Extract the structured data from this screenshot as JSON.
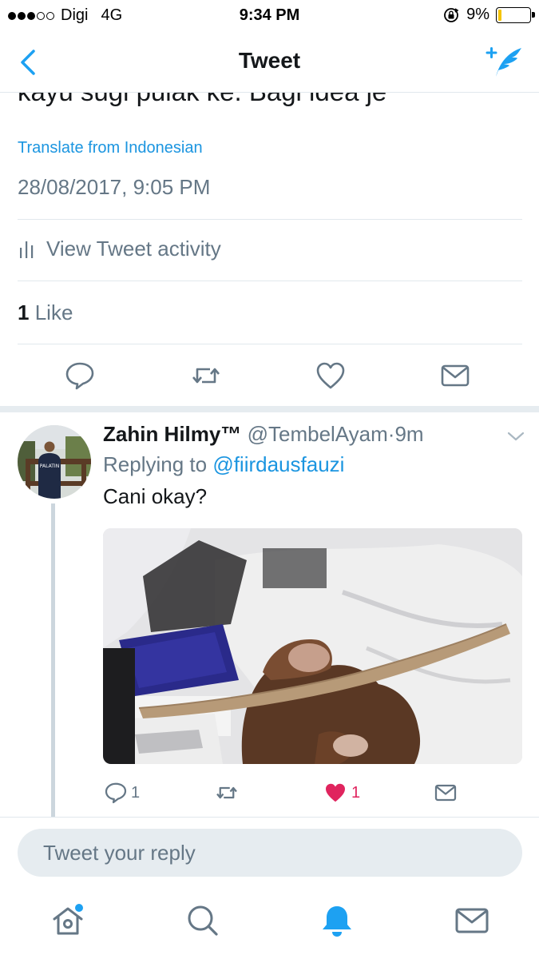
{
  "status_bar": {
    "carrier": "Digi",
    "network": "4G",
    "time": "9:34 PM",
    "battery": "9%",
    "battery_color": "#f5c400"
  },
  "nav": {
    "title": "Tweet",
    "back_icon": "chevron-left-icon",
    "compose_icon": "compose-quill-icon"
  },
  "tweet": {
    "text": "kayu sugi pulak ke. Bagi idea je",
    "translate_label": "Translate from Indonesian",
    "timestamp": "28/08/2017, 9:05 PM",
    "activity_label": "View Tweet activity",
    "likes_count": "1",
    "likes_label": "Like"
  },
  "reply": {
    "display_name": "Zahin Hilmy™",
    "handle": "@TembelAyam",
    "separator": "·",
    "age": "9m",
    "replying_prefix": "Replying to",
    "replying_handle": "@fiirdausfauzi",
    "text": "Cani okay?",
    "avatar_shirt_text": "PALATIN",
    "reply_count": "1",
    "like_count": "1"
  },
  "composer": {
    "placeholder": "Tweet your reply"
  },
  "colors": {
    "accent": "#1da1f2",
    "link": "#1b95e0",
    "secondary_text": "#657786",
    "like_red": "#e0245e"
  },
  "tabs": [
    "home-icon",
    "search-icon",
    "notifications-bell-icon",
    "messages-icon"
  ]
}
